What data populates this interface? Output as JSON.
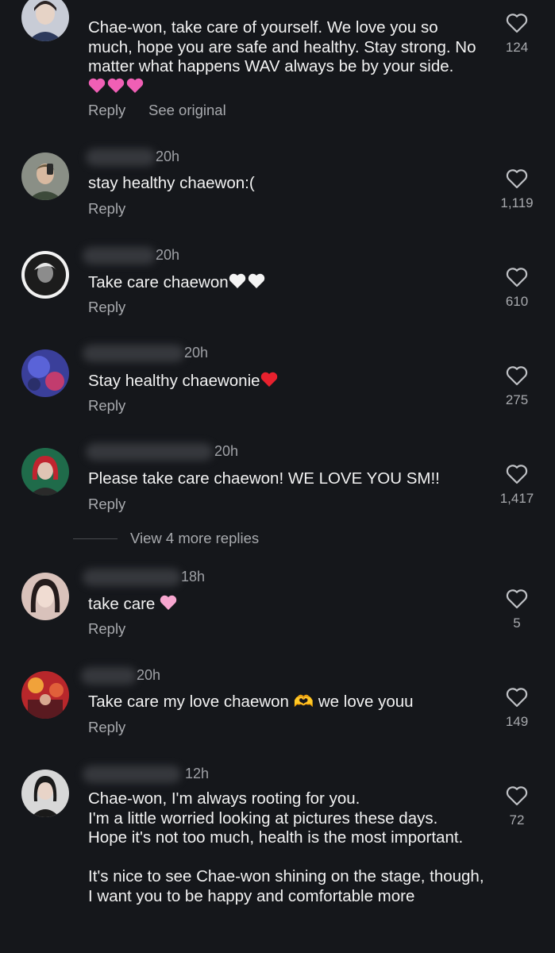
{
  "comments": [
    {
      "time": "",
      "text": "Chae-won, take care of yourself. We love you so much, hope you are safe and healthy. Stay strong. No matter what happens WAV always be by your side.",
      "trailing_emoji": "💗💗💗",
      "reply_label": "Reply",
      "see_original_label": "See original",
      "likes": "124",
      "colors": {
        "avatar_bg": "#c8ccd6",
        "avatar_accent": "#2d3a5c"
      }
    },
    {
      "time": "20h",
      "text": "stay healthy chaewon:(",
      "trailing_emoji": "",
      "reply_label": "Reply",
      "likes": "1,119",
      "colors": {
        "avatar_bg": "#8a8f86",
        "avatar_accent": "#3d4a3a"
      }
    },
    {
      "time": "20h",
      "text": "Take care chaewon",
      "trailing_emoji": "🤍🤍",
      "reply_label": "Reply",
      "likes": "610",
      "colors": {
        "avatar_bg": "#2a2a2a",
        "avatar_accent": "#e8e8e8"
      }
    },
    {
      "time": "20h",
      "text": "Stay healthy chaewonie",
      "trailing_emoji": "❤️",
      "reply_label": "Reply",
      "likes": "275",
      "colors": {
        "avatar_bg": "#3a3f9a",
        "avatar_accent": "#c23c6e"
      }
    },
    {
      "time": "20h",
      "text": "Please take care chaewon! WE LOVE YOU SM!!",
      "trailing_emoji": "",
      "reply_label": "Reply",
      "likes": "1,417",
      "colors": {
        "avatar_bg": "#1f6b4a",
        "avatar_accent": "#c0242f"
      }
    },
    {
      "time": "18h",
      "text": "take care",
      "trailing_emoji": "🩷",
      "reply_label": "Reply",
      "likes": "5",
      "colors": {
        "avatar_bg": "#d9c2bb",
        "avatar_accent": "#241b1b"
      }
    },
    {
      "time": "20h",
      "text": "Take care my love chaewon 🫶 we love youu",
      "trailing_emoji": "",
      "reply_label": "Reply",
      "likes": "149",
      "colors": {
        "avatar_bg": "#b8272b",
        "avatar_accent": "#f0a23a"
      }
    },
    {
      "time": "12h",
      "text": "Chae-won, I'm always rooting for you.\nI'm a little worried looking at pictures these days.\nHope it's not too much, health is the most important.\n\nIt's nice to see Chae-won shining on the stage, though,\nI want you to be happy and comfortable more",
      "trailing_emoji": "",
      "reply_label": "",
      "likes": "72",
      "colors": {
        "avatar_bg": "#d8d8d8",
        "avatar_accent": "#1a1a1a"
      }
    }
  ],
  "view_more_replies": "View 4 more replies",
  "icons": {
    "like": "heart-outline-icon"
  },
  "theme": {
    "background": "#15171b",
    "text": "#f2f2f2",
    "muted": "#a8aaae"
  }
}
